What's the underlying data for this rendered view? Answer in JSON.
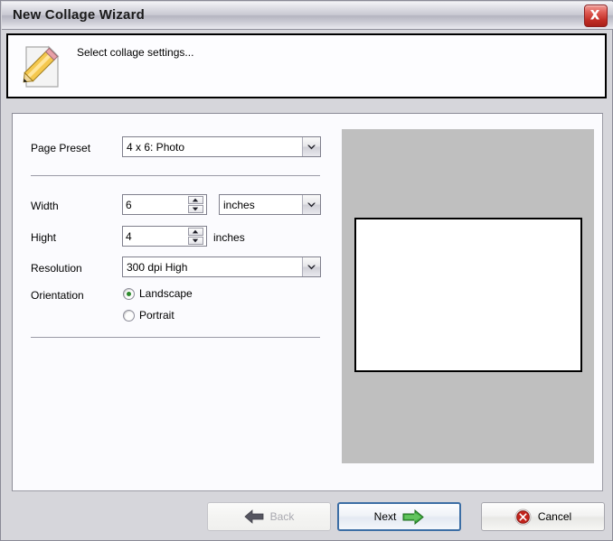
{
  "window": {
    "title": "New Collage Wizard",
    "close_icon": "close-icon"
  },
  "header": {
    "icon": "document-pencil-icon",
    "message": "Select collage settings..."
  },
  "form": {
    "page_preset": {
      "label": "Page Preset",
      "value": "4 x 6: Photo",
      "arrow_icon": "chevron-down-icon"
    },
    "width": {
      "label": "Width",
      "value": "6",
      "unit_value": "inches",
      "up_icon": "triangle-up-icon",
      "down_icon": "triangle-down-icon",
      "arrow_icon": "chevron-down-icon"
    },
    "height": {
      "label": "Hight",
      "value": "4",
      "unit_text": "inches",
      "up_icon": "triangle-up-icon",
      "down_icon": "triangle-down-icon"
    },
    "resolution": {
      "label": "Resolution",
      "value": "300 dpi High",
      "arrow_icon": "chevron-down-icon"
    },
    "orientation": {
      "label": "Orientation",
      "options": [
        {
          "label": "Landscape",
          "selected": true
        },
        {
          "label": "Portrait",
          "selected": false
        }
      ]
    }
  },
  "preview": {
    "background_color": "#bfbfbf",
    "page_color": "#ffffff"
  },
  "footer": {
    "back": {
      "label": "Back",
      "icon": "arrow-left-icon",
      "enabled": false
    },
    "next": {
      "label": "Next",
      "icon": "arrow-right-icon",
      "enabled": true,
      "default": true
    },
    "cancel": {
      "label": "Cancel",
      "icon": "cancel-circle-icon",
      "enabled": true
    }
  },
  "colors": {
    "accent_blue": "#3c6ea5",
    "next_arrow_green": "#3faa3f",
    "cancel_red": "#c3241c",
    "radio_dot_green": "#2d8a2d",
    "preview_gray": "#bfbfbf"
  }
}
